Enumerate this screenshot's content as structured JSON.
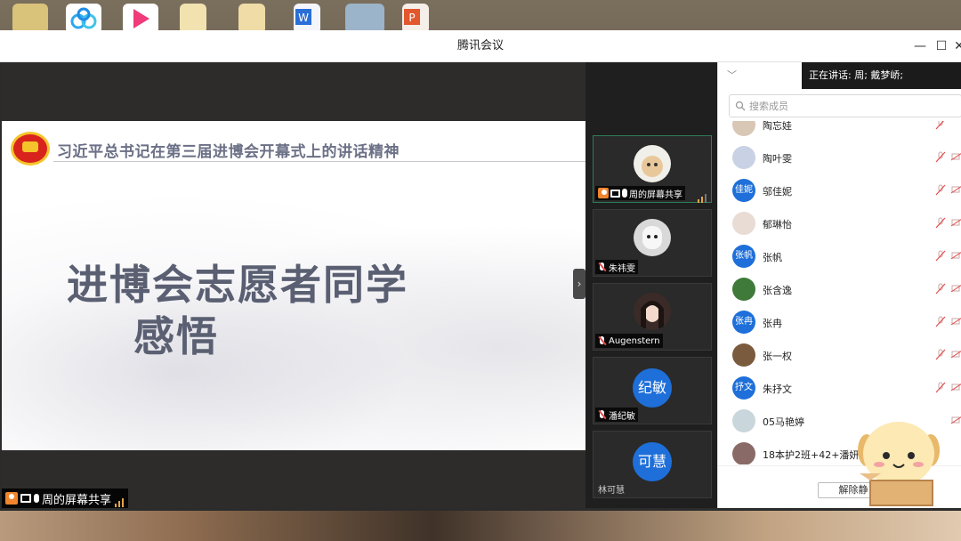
{
  "window": {
    "title": "腾讯会议",
    "minimize_label": "—",
    "maximize_label": "☐",
    "close_label": "✕"
  },
  "slide": {
    "header": "习近平总书记在第三届进博会开幕式上的讲话精神",
    "title_line1": "进博会志愿者同学",
    "title_line2": "感悟"
  },
  "stage": {
    "sharer_label": "周的屏幕共享",
    "collapse_label": "›"
  },
  "videos": [
    {
      "name": "周的屏幕共享",
      "avatar_text": "",
      "sharing": true
    },
    {
      "name": "朱祎雯",
      "avatar_text": ""
    },
    {
      "name": "Augenstern",
      "avatar_text": ""
    },
    {
      "name": "潘纪敏",
      "avatar_text": "纪敏"
    },
    {
      "name": "林可慧",
      "avatar_text": "可慧"
    }
  ],
  "panel": {
    "chevron": "﹀",
    "speaking_label": "正在讲话: 周; 戴梦峤;",
    "search_placeholder": "搜索成员",
    "members": [
      {
        "name": "陶忘娃",
        "avatar_text": "",
        "avatar_color": "#d9c7b5"
      },
      {
        "name": "陶叶雯",
        "avatar_text": "",
        "avatar_color": "#c8d2e4"
      },
      {
        "name": "邬佳妮",
        "avatar_text": "佳妮",
        "avatar_color": "#1e6fd9"
      },
      {
        "name": "郁琳怡",
        "avatar_text": "",
        "avatar_color": "#e9dcd5"
      },
      {
        "name": "张帆",
        "avatar_text": "张帆",
        "avatar_color": "#1e6fd9"
      },
      {
        "name": "张含逸",
        "avatar_text": "",
        "avatar_color": "#3f7a3a"
      },
      {
        "name": "张冉",
        "avatar_text": "张冉",
        "avatar_color": "#1e6fd9"
      },
      {
        "name": "张一权",
        "avatar_text": "",
        "avatar_color": "#7b5b3e"
      },
      {
        "name": "朱抒文",
        "avatar_text": "抒文",
        "avatar_color": "#1e6fd9"
      },
      {
        "name": "05马艳婷",
        "avatar_text": "",
        "avatar_color": "#c9d6dc"
      },
      {
        "name": "18本护2班+42+潘妍妍",
        "avatar_text": "",
        "avatar_color": "#8a6a66"
      }
    ],
    "unmute_label": "解除静"
  },
  "colors": {
    "accent_blue": "#1e6fd9",
    "mic_muted_red": "#e34b4b",
    "active_tile_border": "#2d7d5a"
  }
}
